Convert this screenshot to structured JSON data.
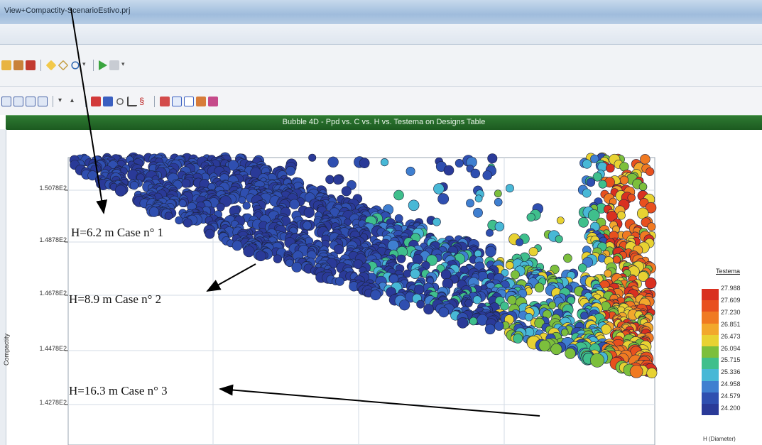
{
  "window": {
    "title": "View+Compactity-ScenarioEstivo.prj"
  },
  "chart_panel": {
    "title": "Bubble 4D - Ppd vs. C vs. H vs. Testema on Designs Table"
  },
  "chart_data": {
    "type": "scatter",
    "title": "Bubble 4D - Ppd vs. C vs. H vs. Testema on Designs Table",
    "ylabel": "Compactity",
    "y_ticks": [
      "1.5078E2",
      "1.4878E2",
      "1.4678E2",
      "1.4478E2",
      "1.4278E2"
    ],
    "grid": true,
    "legend": {
      "title": "Testema",
      "placement": "right",
      "values": [
        "27.988",
        "27.609",
        "27.230",
        "26.851",
        "26.473",
        "26.094",
        "25.715",
        "25.336",
        "24.958",
        "24.579",
        "24.200"
      ],
      "colors": [
        "#d93020",
        "#e8501e",
        "#f07a22",
        "#f2a82c",
        "#e8d232",
        "#7cbf3c",
        "#3fbf8c",
        "#48b8d6",
        "#3f7fd0",
        "#2f4fb0",
        "#2a3a98"
      ],
      "size_label": "H (Diameter)"
    },
    "annotations": [
      "H=6.2 m Case n° 1",
      "H=8.9 m Case n° 2",
      "H=16.3 m Case n° 3"
    ]
  }
}
